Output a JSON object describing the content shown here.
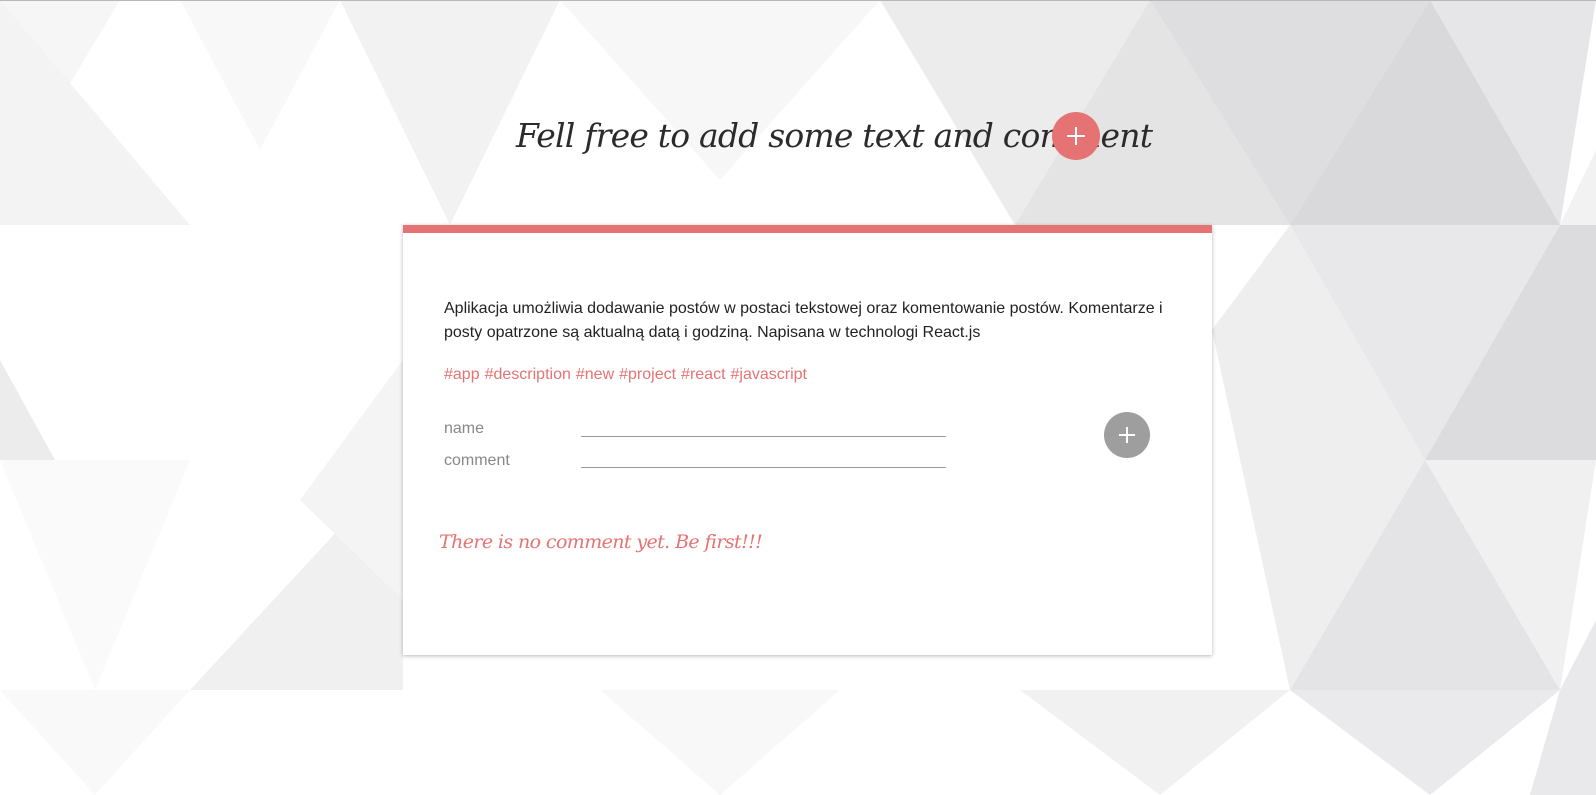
{
  "header": {
    "title": "Fell free to add some text and comment",
    "add_icon": "plus-icon"
  },
  "post": {
    "text": "Aplikacja umożliwia dodawanie postów w postaci tekstowej oraz komentowanie postów. Komentarze i posty opatrzone są aktualną datą i godziną. Napisana w technologi React.js",
    "tags": [
      "#app",
      "#description",
      "#new",
      "#project",
      "#react",
      "#javascript"
    ]
  },
  "comment_form": {
    "name_label": "name",
    "comment_label": "comment",
    "name_value": "",
    "comment_value": "",
    "add_icon": "plus-icon"
  },
  "comments": {
    "empty_message": "There is no comment yet. Be first!!!"
  },
  "colors": {
    "accent": "#e57373",
    "button_gray": "#9e9e9e",
    "text": "#222222",
    "label": "#888888"
  }
}
